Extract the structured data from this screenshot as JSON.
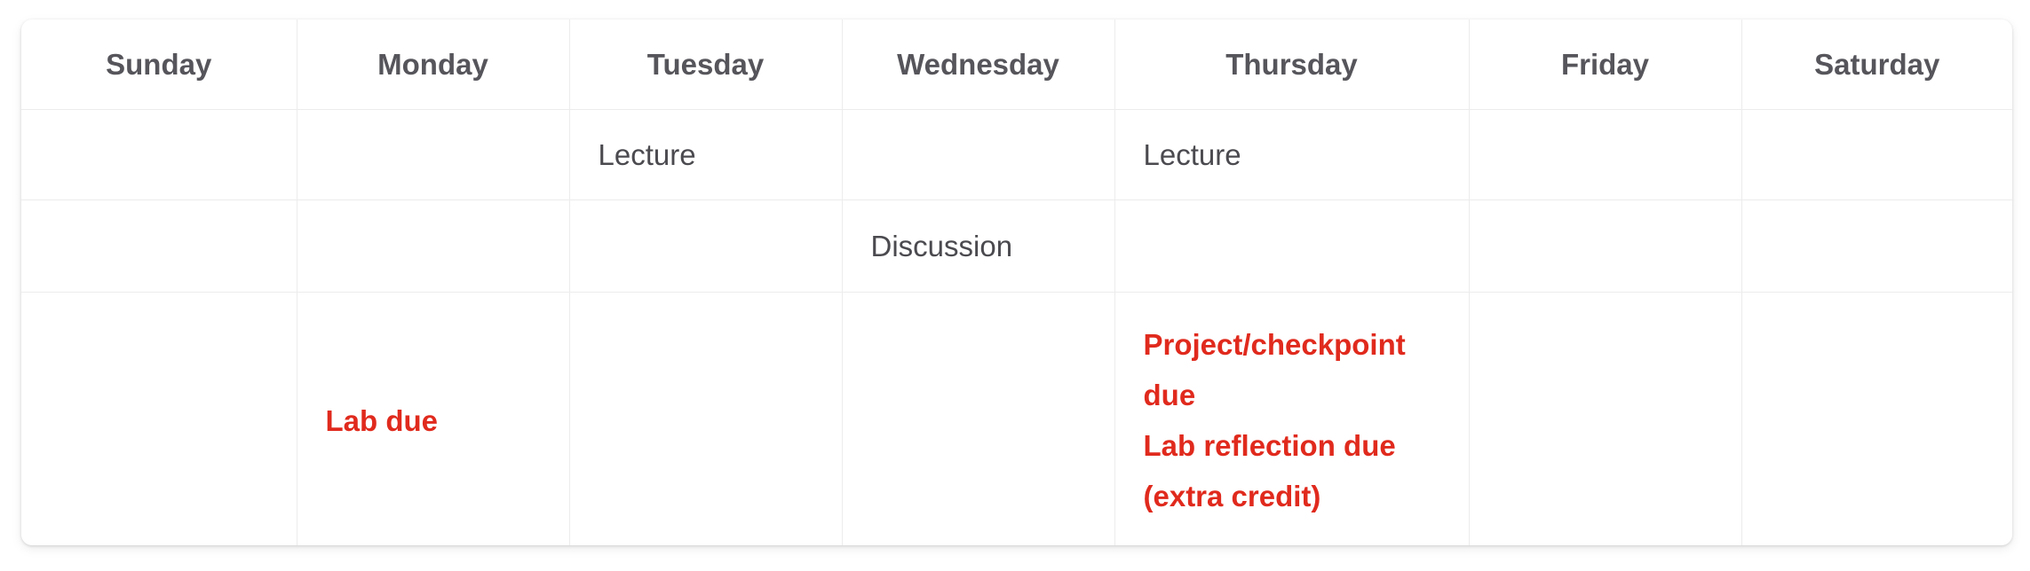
{
  "days": [
    "Sunday",
    "Monday",
    "Tuesday",
    "Wednesday",
    "Thursday",
    "Friday",
    "Saturday"
  ],
  "rows": [
    [
      "",
      "",
      "Lecture",
      "",
      "Lecture",
      "",
      ""
    ],
    [
      "",
      "",
      "",
      "Discussion",
      "",
      "",
      ""
    ],
    [
      "",
      "Lab due",
      "",
      "",
      "Project/checkpoint due",
      "",
      ""
    ]
  ],
  "extra": {
    "thursday_second_due_line1": "Lab reflection due",
    "thursday_second_due_line2": "(extra credit)"
  },
  "colors": {
    "due_text": "#e02a1d",
    "header_text": "#55555b",
    "cell_text": "#4a4a4f",
    "grid_line": "#ececec"
  }
}
